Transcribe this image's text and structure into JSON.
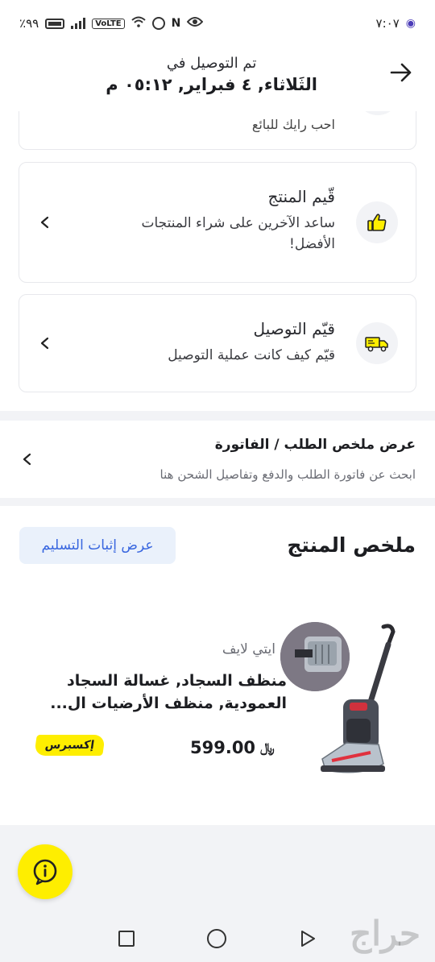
{
  "status_bar": {
    "time": "٧:٠٧",
    "battery": "٪٩٩"
  },
  "header": {
    "subtitle": "تم التوصيل في",
    "title": "الثَلاثاء, ٤ فبراير, ٠٥:١٢ م"
  },
  "partial_card": {
    "text": "احب رايك للبائع"
  },
  "rate_product": {
    "title": "قّيم المنتج",
    "description": "ساعد الآخرين على شراء المنتجات الأفضل!"
  },
  "rate_delivery": {
    "title": "قيّم التوصيل",
    "description": "قيّم كيف كانت عملية التوصيل"
  },
  "invoice": {
    "title": "عرض ملخص الطلب / الفاتورة",
    "description": "ابحث عن فاتورة الطلب والدفع وتفاصيل الشحن هنا"
  },
  "summary": {
    "title": "ملخص المنتج",
    "proof_button": "عرض إثبات التسليم"
  },
  "product": {
    "brand": "ايتي لايف",
    "name": "منظف السجاد, غسالة السجاد العمودية, منظف الأرضيات ال...",
    "price": "599.00",
    "currency_symbol": "﷼",
    "badge": "إكسبرس"
  },
  "watermark": "حراج",
  "colors": {
    "accent_yellow": "#feee00",
    "link_blue": "#3866df",
    "proof_bg": "#eaf1fb"
  }
}
